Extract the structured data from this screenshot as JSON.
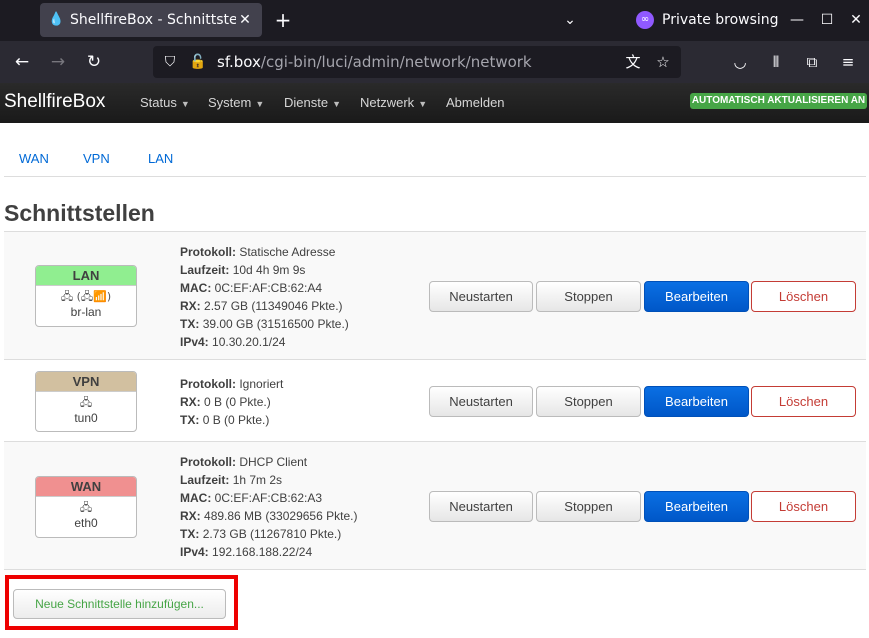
{
  "browser": {
    "tab_title": "ShellfireBox - Schnittstellen",
    "tab_close": "✕",
    "new_tab": "+",
    "private_label": "Private browsing",
    "url_host": "sf.box",
    "url_path": "/cgi-bin/luci/admin/network/network"
  },
  "app": {
    "brand": "ShellfireBox",
    "menu": [
      "Status",
      "System",
      "Dienste",
      "Netzwerk",
      "Abmelden"
    ],
    "auto_refresh": "AUTOMATISCH AKTUALISIEREN AN"
  },
  "subtabs": [
    "WAN",
    "VPN",
    "LAN"
  ],
  "page_title": "Schnittstellen",
  "buttons": {
    "restart": "Neustarten",
    "stop": "Stoppen",
    "edit": "Bearbeiten",
    "delete": "Löschen"
  },
  "labels": {
    "protocol": "Protokoll:",
    "uptime": "Laufzeit:",
    "mac": "MAC:",
    "rx": "RX:",
    "tx": "TX:",
    "ipv4": "IPv4:"
  },
  "interfaces": [
    {
      "name": "LAN",
      "color": "#90ee90",
      "device": "br-lan",
      "icons": "🖧 (🖧📶)",
      "protocol": "Statische Adresse",
      "uptime": "10d 4h 9m 9s",
      "mac": "0C:EF:AF:CB:62:A4",
      "rx": "2.57 GB (11349046 Pkte.)",
      "tx": "39.00 GB (31516500 Pkte.)",
      "ipv4": "10.30.20.1/24"
    },
    {
      "name": "VPN",
      "color": "#d2c0a0",
      "device": "tun0",
      "icons": "🖧",
      "protocol": "Ignoriert",
      "rx": "0 B (0 Pkte.)",
      "tx": "0 B (0 Pkte.)"
    },
    {
      "name": "WAN",
      "color": "#f09090",
      "device": "eth0",
      "icons": "🖧",
      "protocol": "DHCP Client",
      "uptime": "1h 7m 2s",
      "mac": "0C:EF:AF:CB:62:A3",
      "rx": "489.86 MB (33029656 Pkte.)",
      "tx": "2.73 GB (11267810 Pkte.)",
      "ipv4": "192.168.188.22/24"
    }
  ],
  "add_interface": "Neue Schnittstelle hinzufügen..."
}
